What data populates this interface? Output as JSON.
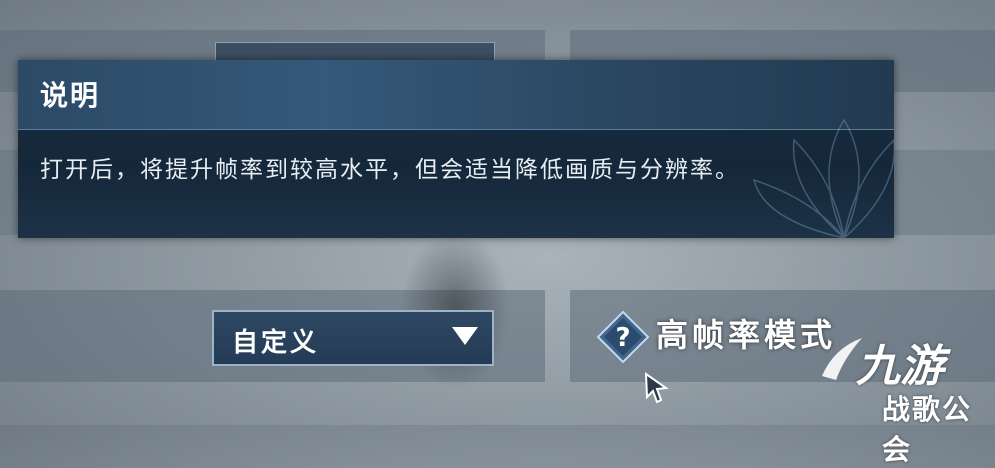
{
  "dialog": {
    "title": "说明",
    "body": "打开后，将提升帧率到较高水平，但会适当降低画质与分辨率。"
  },
  "quality_dropdown": {
    "selected": "自定义"
  },
  "setting": {
    "label": "高帧率模式"
  },
  "watermark": {
    "logo": "九游",
    "subtitle": "战歌公会"
  },
  "colors": {
    "dialog_bg": "#15283a",
    "dialog_header": "#34597a",
    "dropdown_bg": "#2e4863",
    "accent_border": "#9db3c8"
  },
  "icons": [
    "help-icon",
    "dropdown-arrow-icon",
    "cursor-icon",
    "lotus-decoration"
  ]
}
